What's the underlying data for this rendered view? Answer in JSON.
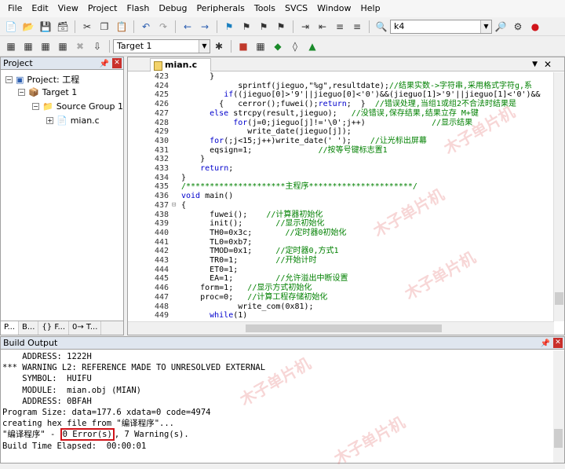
{
  "menu": [
    "File",
    "Edit",
    "View",
    "Project",
    "Flash",
    "Debug",
    "Peripherals",
    "Tools",
    "SVCS",
    "Window",
    "Help"
  ],
  "toolbar": {
    "find_value": "k4",
    "target": "Target 1"
  },
  "project": {
    "title": "Project",
    "root": "Project: 工程",
    "target": "Target 1",
    "group": "Source Group 1",
    "file": "mian.c",
    "tabs": [
      "P...",
      "B...",
      "{} F...",
      "0→ T..."
    ]
  },
  "editor": {
    "tab": "mian.c",
    "lines": [
      {
        "n": "423",
        "t": "      }"
      },
      {
        "n": "424",
        "t": "            sprintf(jieguo,\"%g\",resultdate);//结果实数->字符串,采用格式字符g,系"
      },
      {
        "n": "425",
        "t": "         if((jieguo[0]>'9'||jieguo[0]<'0')&&(jieguo[1]>'9'||jieguo[1]<'0')&&"
      },
      {
        "n": "426",
        "t": "        {   cerror();fuwei();return;  }  //错误处理,当组1或组2不合法时结果是"
      },
      {
        "n": "427",
        "t": "      else strcpy(result,jieguo);   //没错误,保存结果,结果立存 M+键"
      },
      {
        "n": "428",
        "t": "           for(j=0;jieguo[j]!='\\0';j++)              //显示结果"
      },
      {
        "n": "429",
        "t": "              write_date(jieguo[j]);"
      },
      {
        "n": "430",
        "t": "      for(;j<15;j++)write_date(' ');    //让光标出屏幕"
      },
      {
        "n": "431",
        "t": "      eqsign=1;              //按等号键标志置1"
      },
      {
        "n": "432",
        "t": "    }"
      },
      {
        "n": "433",
        "t": "    return;"
      },
      {
        "n": "434",
        "t": "}"
      },
      {
        "n": "435",
        "t": "/*********************主程序**********************/"
      },
      {
        "n": "436",
        "t": "void main()"
      },
      {
        "n": "437",
        "t": "{"
      },
      {
        "n": "438",
        "t": "      fuwei();    //计算器初始化"
      },
      {
        "n": "439",
        "t": "      init();       //显示初始化"
      },
      {
        "n": "440",
        "t": "      TH0=0x3c;       //定时器0初始化"
      },
      {
        "n": "441",
        "t": "      TL0=0xb7;"
      },
      {
        "n": "442",
        "t": "      TMOD=0x1;     //定时器0,方式1"
      },
      {
        "n": "443",
        "t": "      TR0=1;        //开始计时"
      },
      {
        "n": "444",
        "t": "      ET0=1;"
      },
      {
        "n": "445",
        "t": "      EA=1;         //允许溢出中断设置"
      },
      {
        "n": "446",
        "t": "    form=1;   //显示方式初始化"
      },
      {
        "n": "447",
        "t": "    proc=0;   //计算工程存储初始化"
      },
      {
        "n": "448",
        "t": "            write_com(0x81);"
      },
      {
        "n": "449",
        "t": "      while(1)"
      }
    ]
  },
  "build": {
    "title": "Build Output",
    "lines": [
      "    ADDRESS: 1222H",
      "*** WARNING L2: REFERENCE MADE TO UNRESOLVED EXTERNAL",
      "    SYMBOL:  HUIFU",
      "    MODULE:  mian.obj (MIAN)",
      "    ADDRESS: 0BFAH",
      "Program Size: data=177.6 xdata=0 code=4974",
      "creating hex file from \"编译程序\"..."
    ],
    "result_prefix": "\"编译程序\" - ",
    "result_errors": "0 Error(s)",
    "result_suffix": ", 7 Warning(s).",
    "elapsed": "Build Time Elapsed:  00:00:01"
  },
  "watermark": "木子单片机"
}
